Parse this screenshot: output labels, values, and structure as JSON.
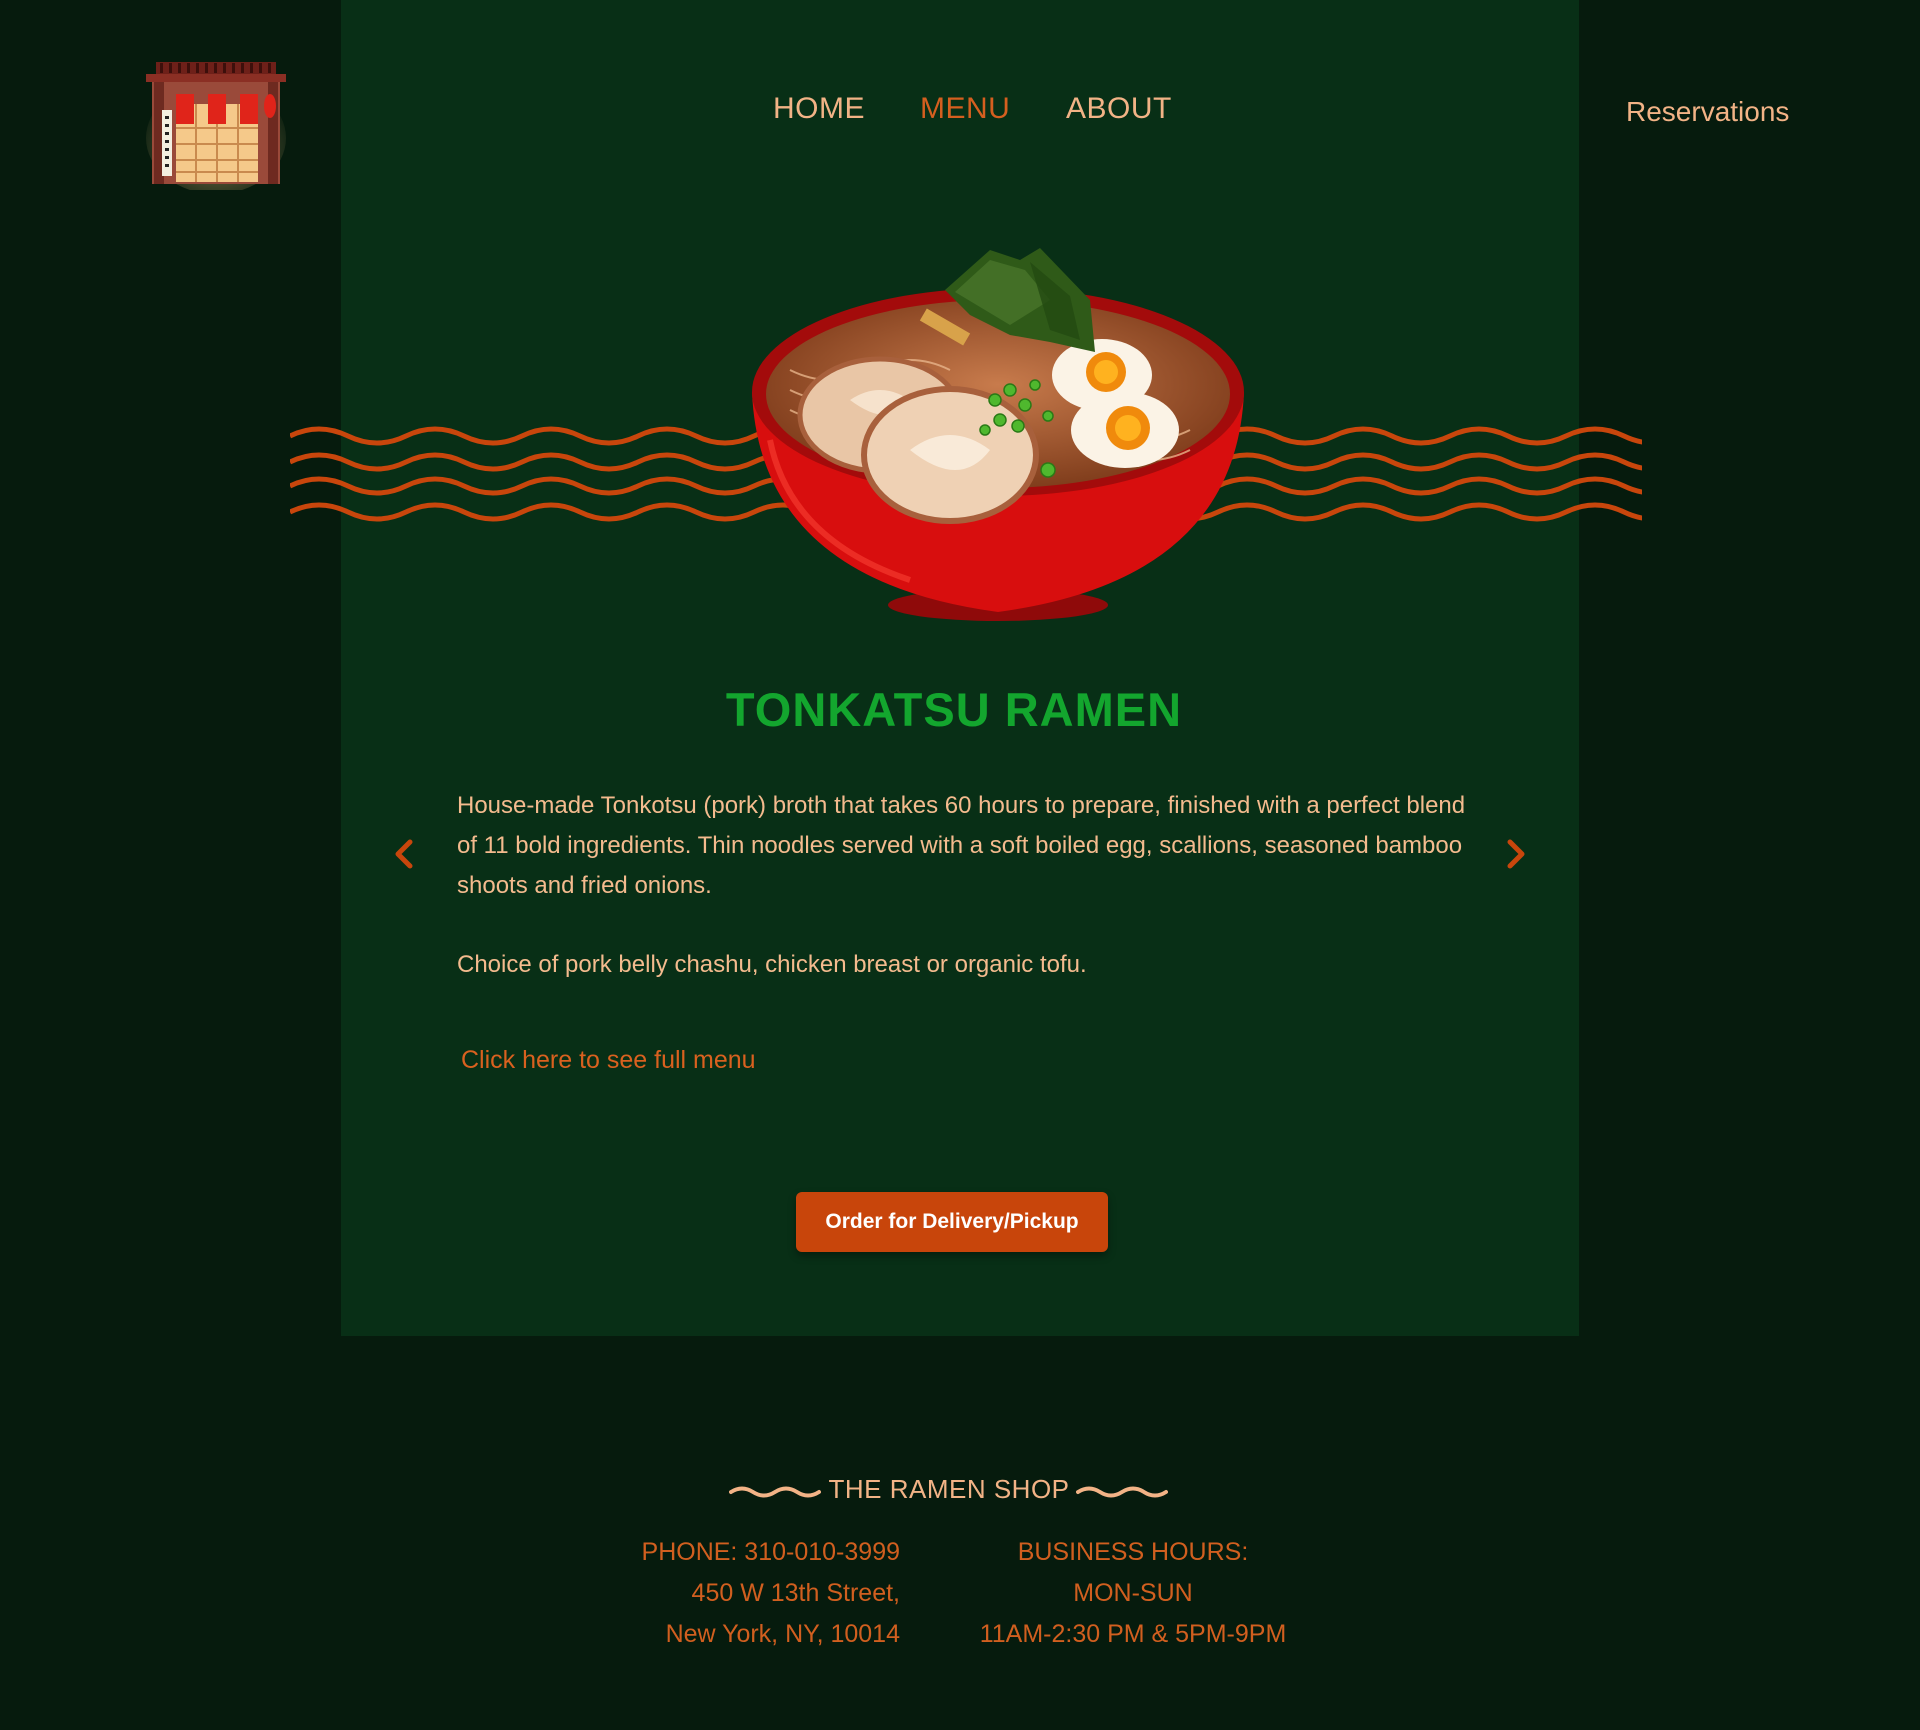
{
  "nav": {
    "items": [
      {
        "label": "HOME",
        "active": false
      },
      {
        "label": "MENU",
        "active": true
      },
      {
        "label": "ABOUT",
        "active": false
      }
    ],
    "reservations_label": "Reservations"
  },
  "dish": {
    "title": "TONKATSU RAMEN",
    "description": "House-made Tonkotsu (pork) broth that takes 60 hours to prepare, finished with a perfect blend of 11 bold ingredients. Thin noodles served with a soft boiled egg, scallions, seasoned bamboo shoots and fried onions.",
    "choice": "Choice of pork belly chashu, chicken breast or organic tofu.",
    "menu_link": "Click here to see full menu",
    "prev_icon": "chevron-left-icon",
    "next_icon": "chevron-right-icon"
  },
  "order_button": "Order for Delivery/Pickup",
  "footer": {
    "shop_name": "THE RAMEN SHOP",
    "phone": "PHONE: 310-010-3999",
    "address_line1": "450 W 13th Street,",
    "address_line2": "New York, NY, 10014",
    "hours_title": "BUSINESS HOURS:",
    "hours_days": "MON-SUN",
    "hours_times": "11AM-2:30 PM & 5PM-9PM"
  },
  "colors": {
    "background": "#061b0d",
    "panel": "#082f16",
    "accent_orange": "#c8450b",
    "title_green": "#13a62e",
    "text_peach": "#f4bb8e"
  }
}
